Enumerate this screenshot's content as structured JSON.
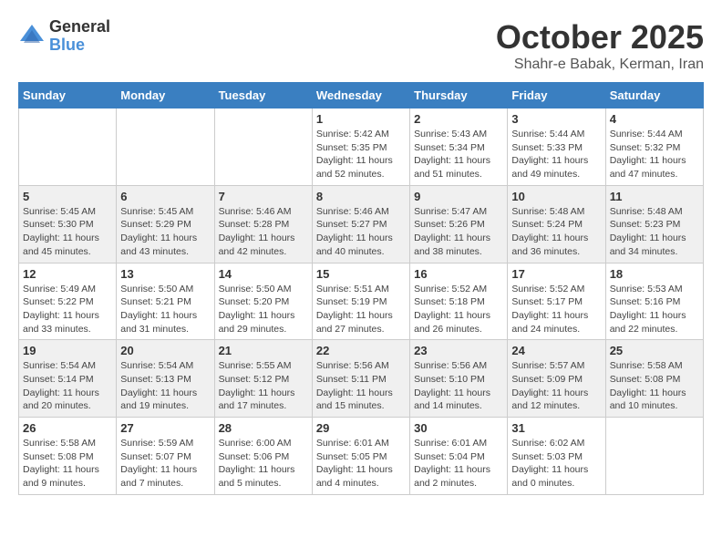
{
  "header": {
    "logo_general": "General",
    "logo_blue": "Blue",
    "month_title": "October 2025",
    "location": "Shahr-e Babak, Kerman, Iran"
  },
  "weekdays": [
    "Sunday",
    "Monday",
    "Tuesday",
    "Wednesday",
    "Thursday",
    "Friday",
    "Saturday"
  ],
  "weeks": [
    [
      {
        "day": "",
        "info": ""
      },
      {
        "day": "",
        "info": ""
      },
      {
        "day": "",
        "info": ""
      },
      {
        "day": "1",
        "info": "Sunrise: 5:42 AM\nSunset: 5:35 PM\nDaylight: 11 hours\nand 52 minutes."
      },
      {
        "day": "2",
        "info": "Sunrise: 5:43 AM\nSunset: 5:34 PM\nDaylight: 11 hours\nand 51 minutes."
      },
      {
        "day": "3",
        "info": "Sunrise: 5:44 AM\nSunset: 5:33 PM\nDaylight: 11 hours\nand 49 minutes."
      },
      {
        "day": "4",
        "info": "Sunrise: 5:44 AM\nSunset: 5:32 PM\nDaylight: 11 hours\nand 47 minutes."
      }
    ],
    [
      {
        "day": "5",
        "info": "Sunrise: 5:45 AM\nSunset: 5:30 PM\nDaylight: 11 hours\nand 45 minutes."
      },
      {
        "day": "6",
        "info": "Sunrise: 5:45 AM\nSunset: 5:29 PM\nDaylight: 11 hours\nand 43 minutes."
      },
      {
        "day": "7",
        "info": "Sunrise: 5:46 AM\nSunset: 5:28 PM\nDaylight: 11 hours\nand 42 minutes."
      },
      {
        "day": "8",
        "info": "Sunrise: 5:46 AM\nSunset: 5:27 PM\nDaylight: 11 hours\nand 40 minutes."
      },
      {
        "day": "9",
        "info": "Sunrise: 5:47 AM\nSunset: 5:26 PM\nDaylight: 11 hours\nand 38 minutes."
      },
      {
        "day": "10",
        "info": "Sunrise: 5:48 AM\nSunset: 5:24 PM\nDaylight: 11 hours\nand 36 minutes."
      },
      {
        "day": "11",
        "info": "Sunrise: 5:48 AM\nSunset: 5:23 PM\nDaylight: 11 hours\nand 34 minutes."
      }
    ],
    [
      {
        "day": "12",
        "info": "Sunrise: 5:49 AM\nSunset: 5:22 PM\nDaylight: 11 hours\nand 33 minutes."
      },
      {
        "day": "13",
        "info": "Sunrise: 5:50 AM\nSunset: 5:21 PM\nDaylight: 11 hours\nand 31 minutes."
      },
      {
        "day": "14",
        "info": "Sunrise: 5:50 AM\nSunset: 5:20 PM\nDaylight: 11 hours\nand 29 minutes."
      },
      {
        "day": "15",
        "info": "Sunrise: 5:51 AM\nSunset: 5:19 PM\nDaylight: 11 hours\nand 27 minutes."
      },
      {
        "day": "16",
        "info": "Sunrise: 5:52 AM\nSunset: 5:18 PM\nDaylight: 11 hours\nand 26 minutes."
      },
      {
        "day": "17",
        "info": "Sunrise: 5:52 AM\nSunset: 5:17 PM\nDaylight: 11 hours\nand 24 minutes."
      },
      {
        "day": "18",
        "info": "Sunrise: 5:53 AM\nSunset: 5:16 PM\nDaylight: 11 hours\nand 22 minutes."
      }
    ],
    [
      {
        "day": "19",
        "info": "Sunrise: 5:54 AM\nSunset: 5:14 PM\nDaylight: 11 hours\nand 20 minutes."
      },
      {
        "day": "20",
        "info": "Sunrise: 5:54 AM\nSunset: 5:13 PM\nDaylight: 11 hours\nand 19 minutes."
      },
      {
        "day": "21",
        "info": "Sunrise: 5:55 AM\nSunset: 5:12 PM\nDaylight: 11 hours\nand 17 minutes."
      },
      {
        "day": "22",
        "info": "Sunrise: 5:56 AM\nSunset: 5:11 PM\nDaylight: 11 hours\nand 15 minutes."
      },
      {
        "day": "23",
        "info": "Sunrise: 5:56 AM\nSunset: 5:10 PM\nDaylight: 11 hours\nand 14 minutes."
      },
      {
        "day": "24",
        "info": "Sunrise: 5:57 AM\nSunset: 5:09 PM\nDaylight: 11 hours\nand 12 minutes."
      },
      {
        "day": "25",
        "info": "Sunrise: 5:58 AM\nSunset: 5:08 PM\nDaylight: 11 hours\nand 10 minutes."
      }
    ],
    [
      {
        "day": "26",
        "info": "Sunrise: 5:58 AM\nSunset: 5:08 PM\nDaylight: 11 hours\nand 9 minutes."
      },
      {
        "day": "27",
        "info": "Sunrise: 5:59 AM\nSunset: 5:07 PM\nDaylight: 11 hours\nand 7 minutes."
      },
      {
        "day": "28",
        "info": "Sunrise: 6:00 AM\nSunset: 5:06 PM\nDaylight: 11 hours\nand 5 minutes."
      },
      {
        "day": "29",
        "info": "Sunrise: 6:01 AM\nSunset: 5:05 PM\nDaylight: 11 hours\nand 4 minutes."
      },
      {
        "day": "30",
        "info": "Sunrise: 6:01 AM\nSunset: 5:04 PM\nDaylight: 11 hours\nand 2 minutes."
      },
      {
        "day": "31",
        "info": "Sunrise: 6:02 AM\nSunset: 5:03 PM\nDaylight: 11 hours\nand 0 minutes."
      },
      {
        "day": "",
        "info": ""
      }
    ]
  ]
}
